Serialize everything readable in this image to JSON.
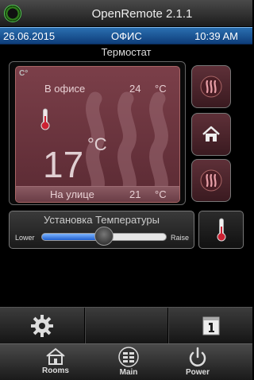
{
  "app": {
    "title": "OpenRemote 2.1.1"
  },
  "status": {
    "date": "26.06.2015",
    "room": "ОФИС",
    "time": "10:39 AM"
  },
  "thermostat": {
    "section_title": "Термостат",
    "badge": "C°",
    "office_label": "В офисе",
    "office_temp": "24",
    "office_unit": "°C",
    "current_temp": "17",
    "current_unit": "°C",
    "outside_label": "На улице",
    "outside_temp": "21",
    "outside_unit": "°C"
  },
  "setpoint": {
    "title": "Установка Температуры",
    "lower_label": "Lower",
    "raise_label": "Raise",
    "slider_fraction": 0.5
  },
  "icons": {
    "heat_up": "heat-wave-icon",
    "home": "home-icon",
    "heat_down": "heat-wave-icon",
    "thermometer": "thermometer-icon",
    "settings": "gear-icon",
    "calendar": "calendar-icon"
  },
  "tabs": [
    {
      "label": "Rooms",
      "icon": "house-icon"
    },
    {
      "label": "Main",
      "icon": "grid-icon"
    },
    {
      "label": "Power",
      "icon": "power-icon"
    }
  ],
  "colors": {
    "accent_blue": "#1f5fcf",
    "card": "#6b3540"
  }
}
